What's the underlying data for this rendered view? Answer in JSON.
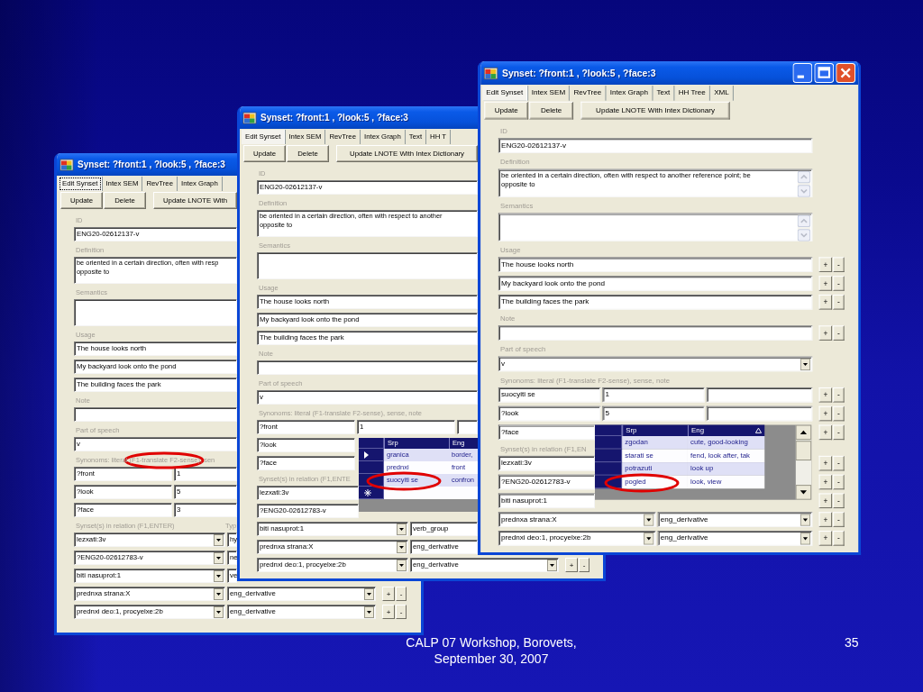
{
  "windows": [
    {
      "title": "Synset: ?front:1 , ?look:5 , ?face:3",
      "tabs": [
        {
          "label": "Edit Synset",
          "selected": true,
          "focused": true
        },
        {
          "label": "Intex SEM",
          "selected": false,
          "focused": false
        },
        {
          "label": "RevTree",
          "selected": false,
          "focused": false
        },
        {
          "label": "Intex Graph",
          "selected": false,
          "focused": false
        }
      ],
      "buttons": [
        "Update",
        "Delete",
        "Update LNOTE With"
      ],
      "form": [
        {
          "kind": "label",
          "texts": [
            "ID"
          ]
        },
        {
          "kind": "single",
          "cells": [
            {
              "kind": "text",
              "value": "ENG20-02612137-v"
            }
          ]
        },
        {
          "kind": "label",
          "texts": [
            "Definition"
          ]
        },
        {
          "kind": "memo",
          "value": "be oriented in a certain direction, often with resp\nopposite to"
        },
        {
          "kind": "label",
          "texts": [
            "Semantics"
          ]
        },
        {
          "kind": "memo"
        },
        {
          "kind": "label",
          "texts": [
            "Usage"
          ]
        },
        {
          "kind": "single",
          "cells": [
            {
              "kind": "text",
              "value": "The house looks north"
            }
          ]
        },
        {
          "kind": "single",
          "cells": [
            {
              "kind": "text",
              "value": "My backyard look onto the pond"
            }
          ]
        },
        {
          "kind": "single",
          "cells": [
            {
              "kind": "text",
              "value": "The building faces the park"
            }
          ]
        },
        {
          "kind": "label",
          "texts": [
            "Note"
          ]
        },
        {
          "kind": "single",
          "cells": [
            {
              "kind": "text"
            }
          ]
        },
        {
          "kind": "label",
          "texts": [
            "Part of speech"
          ]
        },
        {
          "kind": "single",
          "cells": [
            {
              "kind": "text",
              "value": "v"
            }
          ]
        },
        {
          "kind": "label",
          "texts": [
            "Synonoms: literal (F1-translate F2-sense), sen"
          ],
          "circled": true
        },
        {
          "kind": "synonym",
          "cells": [
            {
              "kind": "text",
              "value": "?front"
            },
            {
              "kind": "text",
              "value": "1"
            }
          ]
        },
        {
          "kind": "synonym",
          "cells": [
            {
              "kind": "text",
              "value": "?look"
            },
            {
              "kind": "text",
              "value": "5"
            }
          ]
        },
        {
          "kind": "synonym",
          "cells": [
            {
              "kind": "text",
              "value": "?face"
            },
            {
              "kind": "text",
              "value": "3"
            }
          ]
        },
        {
          "kind": "label",
          "texts": [
            "Synset(s) in relation (F1,ENTER)",
            "Typ"
          ]
        },
        {
          "kind": "relation",
          "cells": [
            {
              "kind": "combo",
              "value": "lezxati:3v"
            },
            {
              "kind": "text",
              "value": "hy"
            }
          ]
        },
        {
          "kind": "relation",
          "cells": [
            {
              "kind": "combo",
              "value": "?ENG20-02612783-v"
            },
            {
              "kind": "text",
              "value": "ne"
            }
          ]
        },
        {
          "kind": "relation",
          "cells": [
            {
              "kind": "combo",
              "value": "biti nasuprot:1"
            },
            {
              "kind": "text",
              "value": "ve"
            }
          ]
        },
        {
          "kind": "relation",
          "cells": [
            {
              "kind": "combo",
              "value": "prednxa strana:X"
            },
            {
              "kind": "combo",
              "value": "eng_derivative"
            }
          ],
          "buttons": [
            "+",
            "-"
          ]
        },
        {
          "kind": "relation",
          "cells": [
            {
              "kind": "combo",
              "value": "prednxi deo:1, procyelxe:2b"
            },
            {
              "kind": "combo",
              "value": "eng_derivative"
            }
          ],
          "buttons": [
            "+",
            "-"
          ]
        }
      ]
    },
    {
      "title": "Synset: ?front:1 , ?look:5 , ?face:3",
      "tabs": [
        {
          "label": "Edit Synset",
          "selected": true
        },
        {
          "label": "Intex SEM",
          "selected": false
        },
        {
          "label": "RevTree",
          "selected": false
        },
        {
          "label": "Intex Graph",
          "selected": false
        },
        {
          "label": "Text",
          "selected": false
        },
        {
          "label": "HH T",
          "selected": false
        }
      ],
      "buttons": [
        "Update",
        "Delete",
        "Update LNOTE With Intex Dictionary"
      ],
      "form": [
        {
          "kind": "label",
          "texts": [
            "ID"
          ]
        },
        {
          "kind": "single",
          "cells": [
            {
              "kind": "text",
              "value": "ENG20-02612137-v"
            }
          ]
        },
        {
          "kind": "label",
          "texts": [
            "Definition"
          ]
        },
        {
          "kind": "memo",
          "value": "be oriented in a certain direction, often with respect to another\nopposite to"
        },
        {
          "kind": "label",
          "texts": [
            "Semantics"
          ]
        },
        {
          "kind": "memo"
        },
        {
          "kind": "label",
          "texts": [
            "Usage"
          ]
        },
        {
          "kind": "single",
          "cells": [
            {
              "kind": "text",
              "value": "The house looks north"
            }
          ]
        },
        {
          "kind": "single",
          "cells": [
            {
              "kind": "text",
              "value": "My backyard look onto the pond"
            }
          ]
        },
        {
          "kind": "single",
          "cells": [
            {
              "kind": "text",
              "value": "The building faces the park"
            }
          ]
        },
        {
          "kind": "label",
          "texts": [
            "Note"
          ]
        },
        {
          "kind": "single",
          "cells": [
            {
              "kind": "text"
            }
          ]
        },
        {
          "kind": "label",
          "texts": [
            "Part of speech"
          ]
        },
        {
          "kind": "single",
          "cells": [
            {
              "kind": "text",
              "value": "v"
            }
          ]
        },
        {
          "kind": "label",
          "texts": [
            "Synonoms: literal (F1-translate F2-sense), sense, note"
          ]
        },
        {
          "kind": "synonym",
          "cells": [
            {
              "kind": "text",
              "value": "?front"
            },
            {
              "kind": "text",
              "value": "1"
            },
            {
              "kind": "text"
            }
          ]
        },
        {
          "kind": "synonym",
          "cells": [
            {
              "kind": "text",
              "value": "?look"
            }
          ]
        },
        {
          "kind": "synonym",
          "cells": [
            {
              "kind": "text",
              "value": "?face"
            }
          ]
        },
        {
          "kind": "label",
          "texts": [
            "Synset(s) in relation (F1,ENTE"
          ]
        },
        {
          "kind": "relation",
          "cells": [
            {
              "kind": "text",
              "value": "lezxati:3v"
            }
          ]
        },
        {
          "kind": "relation",
          "cells": [
            {
              "kind": "text",
              "value": "?ENG20-02612783-v"
            }
          ]
        },
        {
          "kind": "relation",
          "cells": [
            {
              "kind": "combo",
              "value": "biti nasuprot:1"
            },
            {
              "kind": "text",
              "value": "verb_group"
            }
          ]
        },
        {
          "kind": "relation",
          "cells": [
            {
              "kind": "combo",
              "value": "prednxa strana:X"
            },
            {
              "kind": "text",
              "value": "eng_derivative"
            }
          ]
        },
        {
          "kind": "relation",
          "cells": [
            {
              "kind": "combo",
              "value": "prednxi deo:1, procyelxe:2b"
            },
            {
              "kind": "combo",
              "value": "eng_derivative"
            }
          ],
          "buttons": [
            "+",
            "-"
          ]
        }
      ],
      "dropdown": {
        "columns": [
          {
            "label": "Srp"
          },
          {
            "label": "Eng"
          }
        ],
        "rows": [
          {
            "kind": "data",
            "current": true,
            "cells": [
              "granica",
              "border,"
            ]
          },
          {
            "kind": "data",
            "current": false,
            "cells": [
              "prednxi",
              "front"
            ]
          },
          {
            "kind": "data",
            "current": false,
            "cells": [
              "suocyiti se",
              "confron"
            ],
            "circled": true
          },
          {
            "kind": "new",
            "current": false
          }
        ]
      }
    },
    {
      "title": "Synset: ?front:1 , ?look:5 , ?face:3",
      "caption_buttons": true,
      "tabs": [
        {
          "label": "Edit Synset",
          "selected": true
        },
        {
          "label": "Intex SEM",
          "selected": false
        },
        {
          "label": "RevTree",
          "selected": false
        },
        {
          "label": "Intex Graph",
          "selected": false
        },
        {
          "label": "Text",
          "selected": false
        },
        {
          "label": "HH Tree",
          "selected": false
        },
        {
          "label": "XML",
          "selected": false
        }
      ],
      "buttons": [
        "Update",
        "Delete",
        "Update LNOTE With Intex Dictionary"
      ],
      "form": [
        {
          "kind": "label",
          "texts": [
            "ID"
          ]
        },
        {
          "kind": "single",
          "cells": [
            {
              "kind": "text",
              "value": "ENG20-02612137-v"
            }
          ]
        },
        {
          "kind": "label",
          "texts": [
            "Definition"
          ]
        },
        {
          "kind": "memo",
          "value": "be oriented in a certain direction, often with respect to another reference point; be\nopposite to",
          "scrollbar": true
        },
        {
          "kind": "label",
          "texts": [
            "Semantics"
          ]
        },
        {
          "kind": "memo",
          "scrollbar": true
        },
        {
          "kind": "label",
          "texts": [
            "Usage"
          ]
        },
        {
          "kind": "single",
          "cells": [
            {
              "kind": "text",
              "value": "The house looks north"
            }
          ],
          "buttons": [
            "+",
            "-"
          ]
        },
        {
          "kind": "single",
          "cells": [
            {
              "kind": "text",
              "value": "My backyard look onto the pond"
            }
          ],
          "buttons": [
            "+",
            "-"
          ]
        },
        {
          "kind": "single",
          "cells": [
            {
              "kind": "text",
              "value": "The building faces the park"
            }
          ],
          "buttons": [
            "+",
            "-"
          ]
        },
        {
          "kind": "label",
          "texts": [
            "Note"
          ]
        },
        {
          "kind": "single",
          "cells": [
            {
              "kind": "text"
            }
          ],
          "buttons": [
            "+",
            "-"
          ]
        },
        {
          "kind": "label",
          "texts": [
            "Part of speech"
          ]
        },
        {
          "kind": "single",
          "cells": [
            {
              "kind": "combo",
              "value": "v"
            }
          ]
        },
        {
          "kind": "label",
          "texts": [
            "Synonoms: literal (F1-translate F2-sense), sense, note"
          ]
        },
        {
          "kind": "synonym",
          "cells": [
            {
              "kind": "text",
              "value": "suocyiti se"
            },
            {
              "kind": "text",
              "value": "1"
            },
            {
              "kind": "text"
            }
          ],
          "buttons": [
            "+",
            "-"
          ]
        },
        {
          "kind": "synonym",
          "cells": [
            {
              "kind": "text",
              "value": "?look"
            },
            {
              "kind": "text",
              "value": "5"
            },
            {
              "kind": "text"
            }
          ],
          "buttons": [
            "+",
            "-"
          ]
        },
        {
          "kind": "synonym",
          "cells": [
            {
              "kind": "text",
              "value": "?face"
            }
          ],
          "buttons": [
            "+",
            "-"
          ]
        },
        {
          "kind": "label",
          "texts": [
            "Synset(s) in relation (F1,EN"
          ]
        },
        {
          "kind": "relation",
          "cells": [
            {
              "kind": "text",
              "value": "lezxati:3v"
            }
          ],
          "buttons": [
            "+",
            "-"
          ]
        },
        {
          "kind": "relation",
          "cells": [
            {
              "kind": "text",
              "value": "?ENG20-02612783-v"
            }
          ],
          "buttons": [
            "+",
            "-"
          ]
        },
        {
          "kind": "relation",
          "cells": [
            {
              "kind": "text",
              "value": "biti nasuprot:1"
            }
          ],
          "buttons": [
            "+",
            "-"
          ]
        },
        {
          "kind": "relation",
          "cells": [
            {
              "kind": "combo",
              "value": "prednxa strana:X"
            },
            {
              "kind": "combo",
              "value": "eng_derivative"
            }
          ],
          "buttons": [
            "+",
            "-"
          ]
        },
        {
          "kind": "relation",
          "cells": [
            {
              "kind": "combo",
              "value": "prednxi deo:1, procyelxe:2b"
            },
            {
              "kind": "combo",
              "value": "eng_derivative"
            }
          ],
          "buttons": [
            "+",
            "-"
          ]
        }
      ],
      "dropdown": {
        "columns": [
          {
            "label": "Srp"
          },
          {
            "label": "Eng",
            "sorted": true
          }
        ],
        "scrollbar": true,
        "rows": [
          {
            "cells": [
              "zgodan",
              "cute, good-looking"
            ]
          },
          {
            "cells": [
              "starati se",
              "fend, look after, tak"
            ]
          },
          {
            "cells": [
              "potrazuti",
              "look up"
            ]
          },
          {
            "cells": [
              "pogled",
              "look, view"
            ],
            "circled": true
          }
        ]
      }
    }
  ],
  "footer": {
    "lines": [
      "CALP 07 Workshop, Borovets,",
      "September 30, 2007"
    ],
    "page_number": "35"
  }
}
